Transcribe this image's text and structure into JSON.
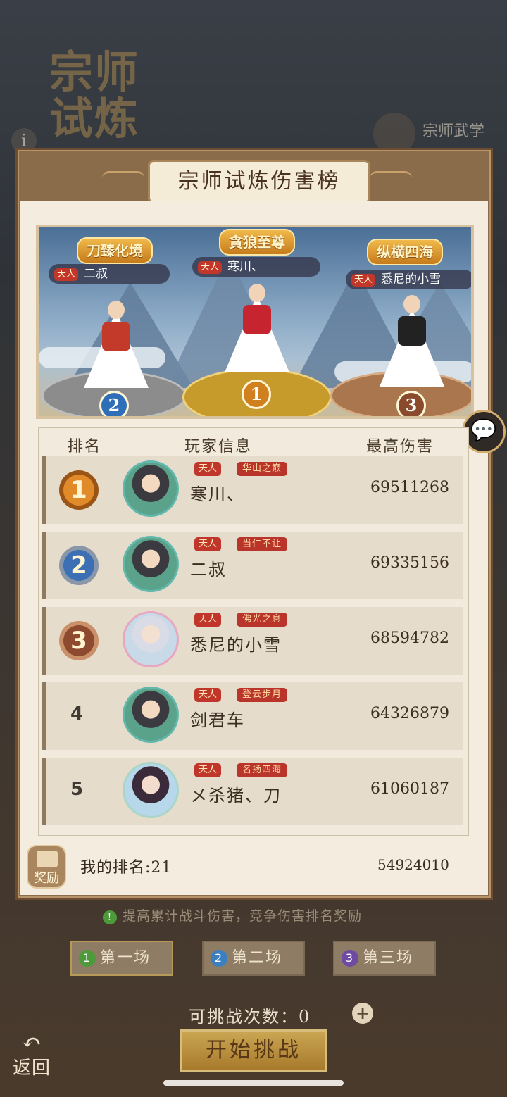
{
  "background": {
    "title": "宗师试炼",
    "top_right_label": "宗师武学"
  },
  "modal": {
    "title": "宗师试炼伤害榜"
  },
  "podium": {
    "first": {
      "title": "貪狼至尊",
      "tag": "天人",
      "name": "寒川、",
      "rank": "1"
    },
    "second": {
      "title": "刀臻化境",
      "tag": "天人",
      "name": "二叔",
      "rank": "2"
    },
    "third": {
      "title": "纵横四海",
      "tag": "天人",
      "name": "悉尼的小雪",
      "rank": "3"
    }
  },
  "table": {
    "headers": {
      "rank": "排名",
      "player": "玩家信息",
      "damage": "最高伤害"
    },
    "rows": [
      {
        "rank": "1",
        "tag": "天人",
        "title": "华山之巅",
        "name": "寒川、",
        "damage": "69511268"
      },
      {
        "rank": "2",
        "tag": "天人",
        "title": "当仁不让",
        "name": "二叔",
        "damage": "69335156"
      },
      {
        "rank": "3",
        "tag": "天人",
        "title": "佛光之息",
        "name": "悉尼的小雪",
        "damage": "68594782"
      },
      {
        "rank": "4",
        "tag": "天人",
        "title": "登云步月",
        "name": "剑君车",
        "damage": "64326879"
      },
      {
        "rank": "5",
        "tag": "天人",
        "title": "名扬四海",
        "name": "メ杀猪、刀",
        "damage": "61060187"
      }
    ]
  },
  "my_rank": {
    "reward_label": "奖励",
    "label": "我的排名:21",
    "damage": "54924010"
  },
  "tip": {
    "icon": "!",
    "text": "提高累计战斗伤害，竞争伤害排名奖励"
  },
  "stages": [
    {
      "num": "1",
      "label": "第一场",
      "color": "#4e9a3a"
    },
    {
      "num": "2",
      "label": "第二场",
      "color": "#3b7fc1"
    },
    {
      "num": "3",
      "label": "第三场",
      "color": "#6e4aa3"
    }
  ],
  "challenge": {
    "chances_label": "可挑战次数：0",
    "plus": "+",
    "start_label": "开始挑战",
    "back_label": "返回"
  }
}
